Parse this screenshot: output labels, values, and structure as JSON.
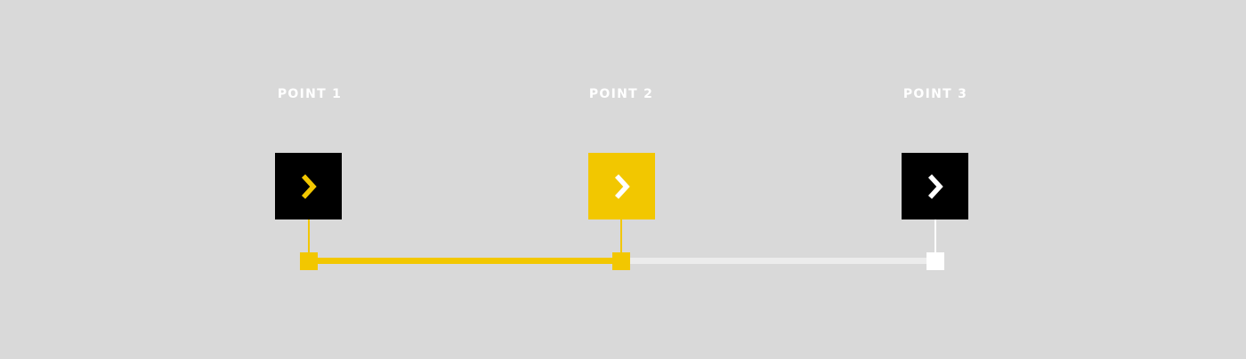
{
  "colors": {
    "background": "#d9d9d9",
    "accent": "#f2c700",
    "dark": "#000000",
    "inactive_track": "#ececec",
    "inactive_node": "#ffffff",
    "label": "#ffffff"
  },
  "stepper": {
    "current_step": 2,
    "steps": [
      {
        "label": "POINT 1",
        "state": "completed",
        "icon": "chevron-right-icon"
      },
      {
        "label": "POINT 2",
        "state": "active",
        "icon": "chevron-right-icon"
      },
      {
        "label": "POINT 3",
        "state": "upcoming",
        "icon": "chevron-right-icon"
      }
    ]
  }
}
